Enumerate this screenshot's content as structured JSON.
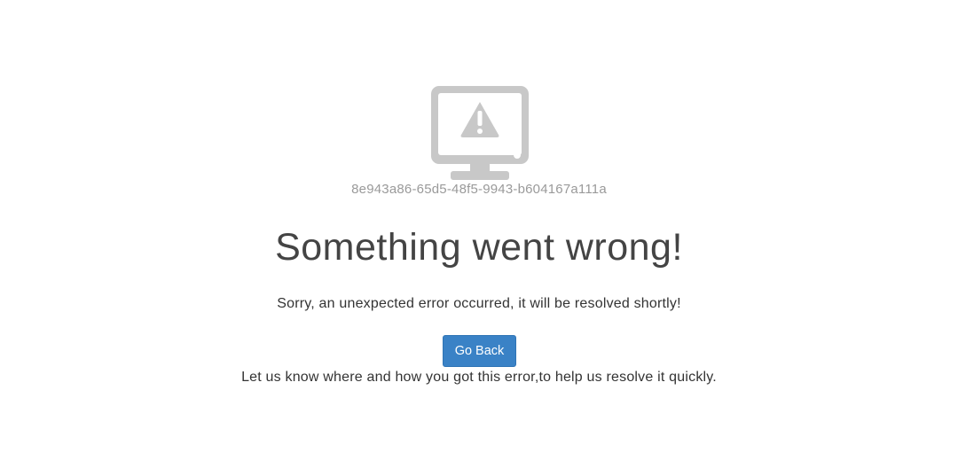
{
  "icon": {
    "name": "monitor-warning-icon",
    "color": "#c8c8c8"
  },
  "error_id": "8e943a86-65d5-48f5-9943-b604167a111a",
  "title": "Something went wrong!",
  "message": "Sorry, an unexpected error occurred, it will be resolved shortly!",
  "go_back_button": {
    "label": "Go Back",
    "color": "#3a82c6"
  },
  "help_text": "Let us know where and how you got this error,to help us resolve it quickly."
}
